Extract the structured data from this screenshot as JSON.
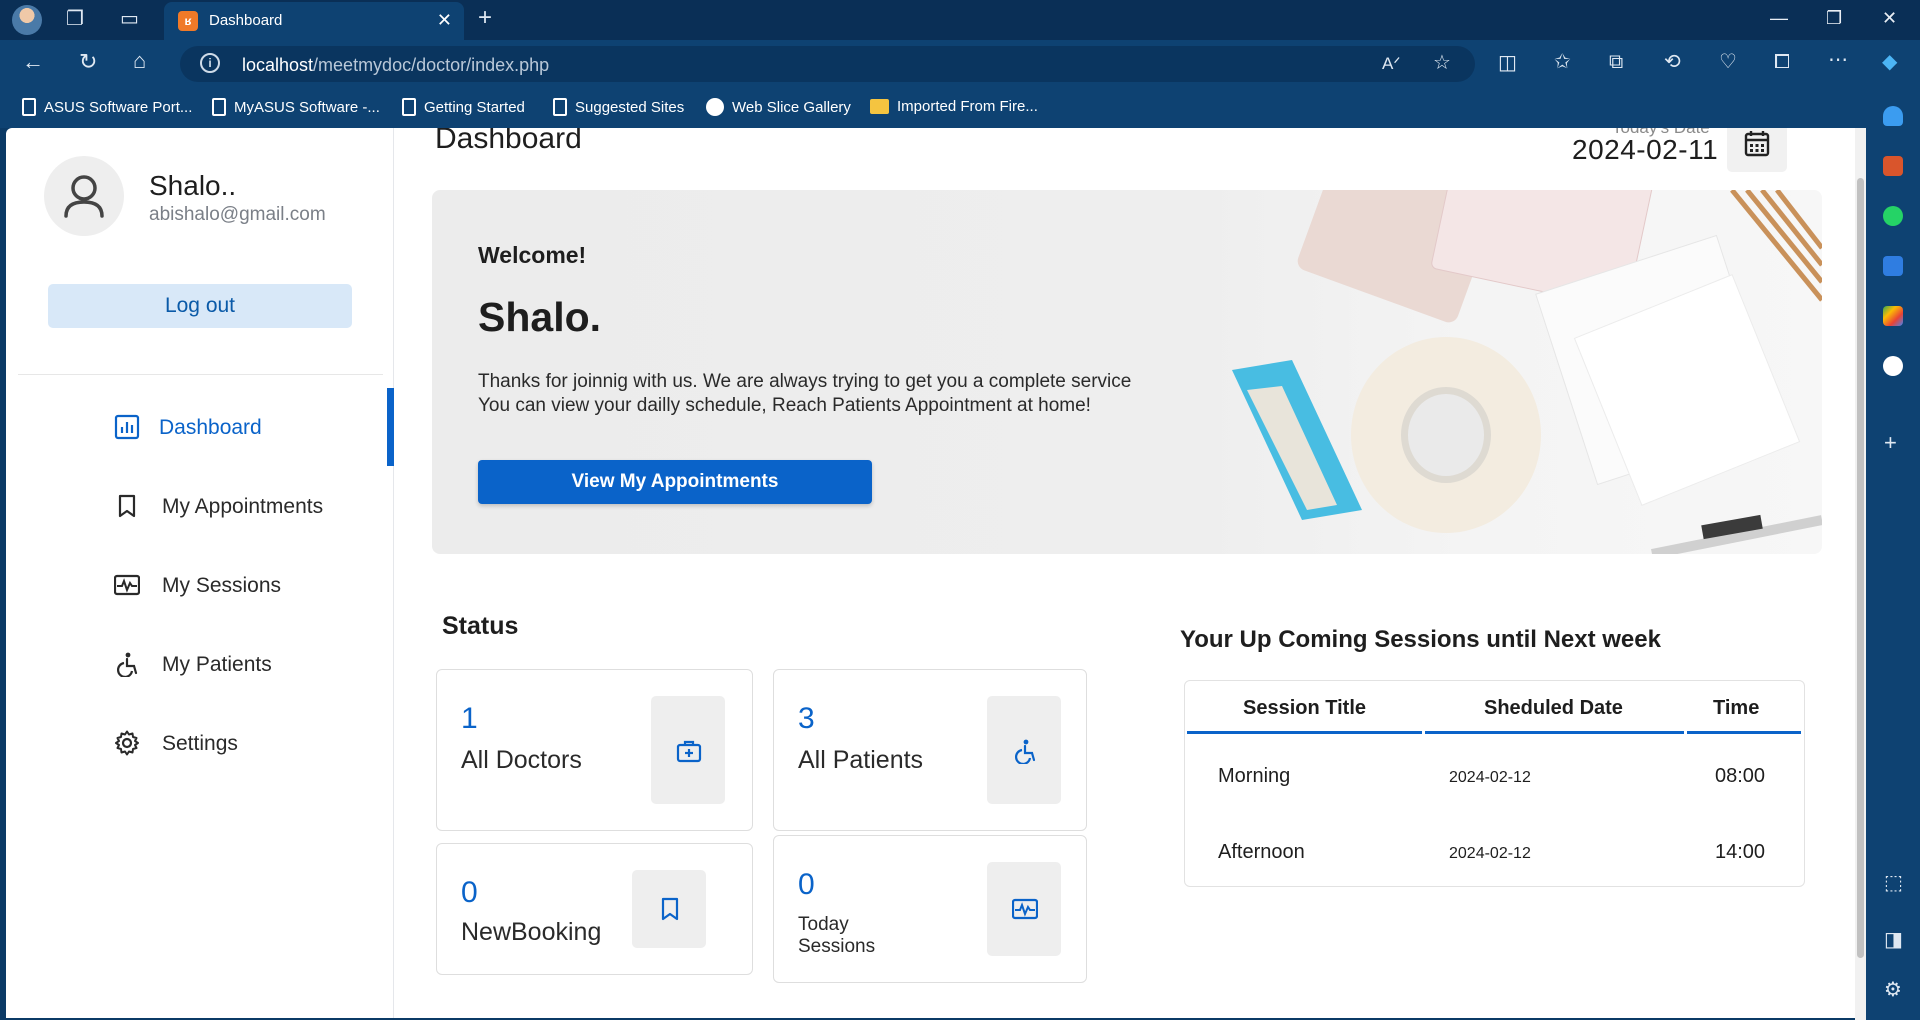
{
  "browser": {
    "tab_title": "Dashboard",
    "tab_favicon": "xampp-icon",
    "url_host": "localhost",
    "url_path": "/meetmydoc/doctor/index.php",
    "favorites": [
      {
        "label": "ASUS Software Port...",
        "icon": "page-icon"
      },
      {
        "label": "MyASUS Software -...",
        "icon": "page-icon"
      },
      {
        "label": "Getting Started",
        "icon": "page-icon"
      },
      {
        "label": "Suggested Sites",
        "icon": "page-icon"
      },
      {
        "label": "Web Slice Gallery",
        "icon": "web-slice-icon"
      },
      {
        "label": "Imported From Fire...",
        "icon": "folder-icon"
      }
    ]
  },
  "sidebar": {
    "user_name": "Shalo..",
    "user_email": "abishalo@gmail.com",
    "logout_label": "Log out",
    "menu": [
      {
        "label": "Dashboard",
        "icon": "dashboard-icon",
        "active": true
      },
      {
        "label": "My Appointments",
        "icon": "bookmark-icon",
        "active": false
      },
      {
        "label": "My Sessions",
        "icon": "sessions-icon",
        "active": false
      },
      {
        "label": "My Patients",
        "icon": "wheelchair-icon",
        "active": false
      },
      {
        "label": "Settings",
        "icon": "gear-icon",
        "active": false
      }
    ]
  },
  "header": {
    "title": "Dashboard",
    "date_caption": "Today's Date",
    "date_value": "2024-02-11"
  },
  "hero": {
    "welcome": "Welcome!",
    "name": "Shalo.",
    "line1": "Thanks for joinnig with us. We are always trying to get you a complete service",
    "line2": "You can view your dailly schedule, Reach Patients Appointment at home!",
    "button_label": "View My Appointments"
  },
  "status": {
    "title": "Status",
    "cards": [
      {
        "value": "1",
        "label": "All Doctors",
        "icon": "medical-kit-icon"
      },
      {
        "value": "3",
        "label": "All Patients",
        "icon": "wheelchair-icon"
      },
      {
        "value": "0",
        "label": "NewBooking",
        "icon": "bookmark-icon"
      },
      {
        "value": "0",
        "label_line1": "Today",
        "label_line2": "Sessions",
        "icon": "sessions-icon"
      }
    ]
  },
  "sessions": {
    "title": "Your Up Coming Sessions until Next week",
    "headers": [
      "Session Title",
      "Sheduled Date",
      "Time"
    ],
    "rows": [
      {
        "title": "Morning",
        "date": "2024-02-12",
        "time": "08:00"
      },
      {
        "title": "Afternoon",
        "date": "2024-02-12",
        "time": "14:00"
      }
    ]
  },
  "colors": {
    "accent": "#0a63c9",
    "chrome_dark": "#0a2f56",
    "chrome": "#0e4272"
  }
}
